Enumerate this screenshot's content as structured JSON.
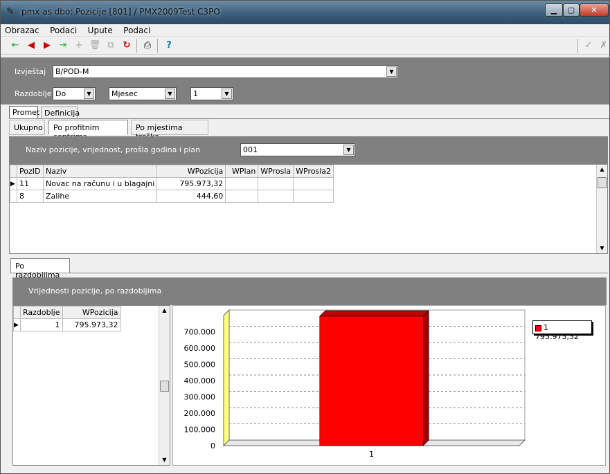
{
  "window": {
    "title": "pmx as dbo: Pozicije [801] / PMX2009Test C3PO"
  },
  "menu": [
    "Obrazac",
    "Podaci",
    "Upute",
    "Podaci"
  ],
  "params": {
    "izvjestaj_label": "Izvještaj",
    "izvjestaj_value": "B/POD-M",
    "razdoblje_label": "Razdoblje",
    "razdoblje_value": "Do",
    "period_type": "Mjesec",
    "period_num": "1"
  },
  "tabs": [
    "Promet",
    "Definicija"
  ],
  "subtabs": [
    "Ukupno",
    "Po profitnim centrima",
    "Po mjestima troška"
  ],
  "top_panel": {
    "label": "Naziv pozicije, vrijednost, prošla godina i plan",
    "combo": "001"
  },
  "top_grid": {
    "headers": [
      "PozID",
      "Naziv",
      "WPozicija",
      "WPlan",
      "WProsla",
      "WProsla2"
    ],
    "rows": [
      [
        "11",
        "Novac na računu i u blagajni",
        "795.973,32",
        "",
        "",
        ""
      ],
      [
        "8",
        "Zalihe",
        "444,60",
        "",
        "",
        ""
      ]
    ]
  },
  "bottom_tab": "Po razdobljima",
  "bottom_panel": {
    "label": "Vrijednosti pozicije, po razdobljima"
  },
  "bottom_grid": {
    "headers": [
      "Razdoblje",
      "WPozicija"
    ],
    "rows": [
      [
        "1",
        "795.973,32"
      ]
    ]
  },
  "chart_data": {
    "type": "bar",
    "categories": [
      "1"
    ],
    "values": [
      795973.32
    ],
    "series": [
      {
        "name": "1 795.973,32",
        "values": [
          795973.32
        ],
        "color": "#ff0000"
      }
    ],
    "ylim": [
      0,
      800000
    ],
    "yticks": [
      "0",
      "100.000",
      "200.000",
      "300.000",
      "400.000",
      "500.000",
      "600.000",
      "700.000"
    ],
    "legend": "top-right",
    "grid": true
  }
}
